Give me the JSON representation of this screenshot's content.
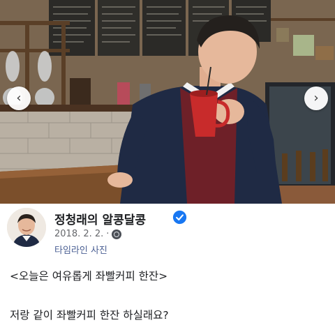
{
  "post": {
    "author": "정청래의 알콩달콩",
    "date": "2018. 2. 2.",
    "separator": "·",
    "album": "타임라인 사진",
    "text_line1": "<오늘은 여유롭게 좌빨커피 한잔>",
    "text_line2": "저랑 같이 좌빨커피 한잔 하실래요?"
  },
  "photo": {
    "prev_arrow": "‹",
    "next_arrow": "›"
  },
  "icons": {
    "verified": "verified-badge-icon",
    "privacy": "globe-icon",
    "prev": "chevron-left-icon",
    "next": "chevron-right-icon"
  },
  "colors": {
    "verified_blue": "#1877f2",
    "cup_red": "#c82b2b",
    "jacket_navy": "#1f2a44",
    "link_blue": "#4a5f93"
  }
}
